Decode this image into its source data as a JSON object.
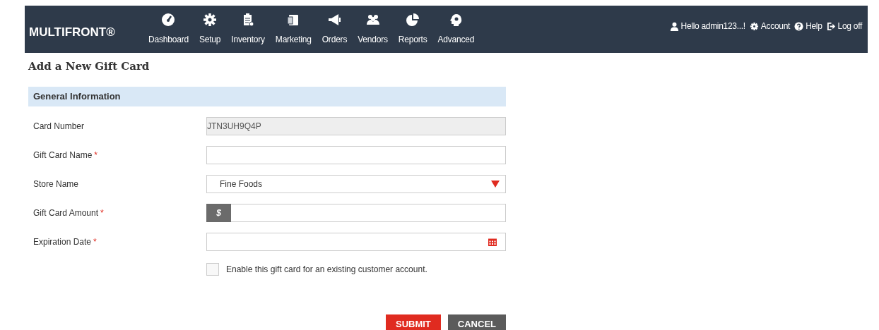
{
  "header": {
    "logo": "MULTIFRONT®",
    "nav": [
      {
        "label": "Dashboard",
        "kind": "gauge"
      },
      {
        "label": "Setup",
        "kind": "gear"
      },
      {
        "label": "Inventory",
        "kind": "clipboard"
      },
      {
        "label": "Marketing",
        "kind": "doc"
      },
      {
        "label": "Orders",
        "kind": "megaphone"
      },
      {
        "label": "Vendors",
        "kind": "people"
      },
      {
        "label": "Reports",
        "kind": "pie"
      },
      {
        "label": "Advanced",
        "kind": "head"
      }
    ],
    "user_links": [
      {
        "label": "Hello admin123...!",
        "kind": "user"
      },
      {
        "label": "Account",
        "kind": "gear"
      },
      {
        "label": "Help",
        "kind": "help"
      },
      {
        "label": "Log off",
        "kind": "logout"
      }
    ]
  },
  "page_title": "Add a New Gift Card",
  "section": {
    "title": "General Information",
    "fields": [
      {
        "label": "Card Number",
        "kind": "readonly",
        "value": "JTN3UH9Q4P"
      },
      {
        "label": "Gift Card Name",
        "mark": "*",
        "kind": "text"
      },
      {
        "label": "Store Name",
        "kind": "select",
        "value": "Fine Foods"
      },
      {
        "label": "Gift Card Amount",
        "mark": "*",
        "kind": "currency",
        "addon": "$"
      },
      {
        "label": "Expiration Date",
        "mark": "*",
        "kind": "date"
      }
    ],
    "checkbox": {
      "label": "Enable this gift card for an existing customer account.",
      "checked": false
    }
  },
  "buttons": [
    {
      "label": "SUBMIT",
      "kind": "primary"
    },
    {
      "label": "CANCEL",
      "kind": "secondary"
    }
  ]
}
